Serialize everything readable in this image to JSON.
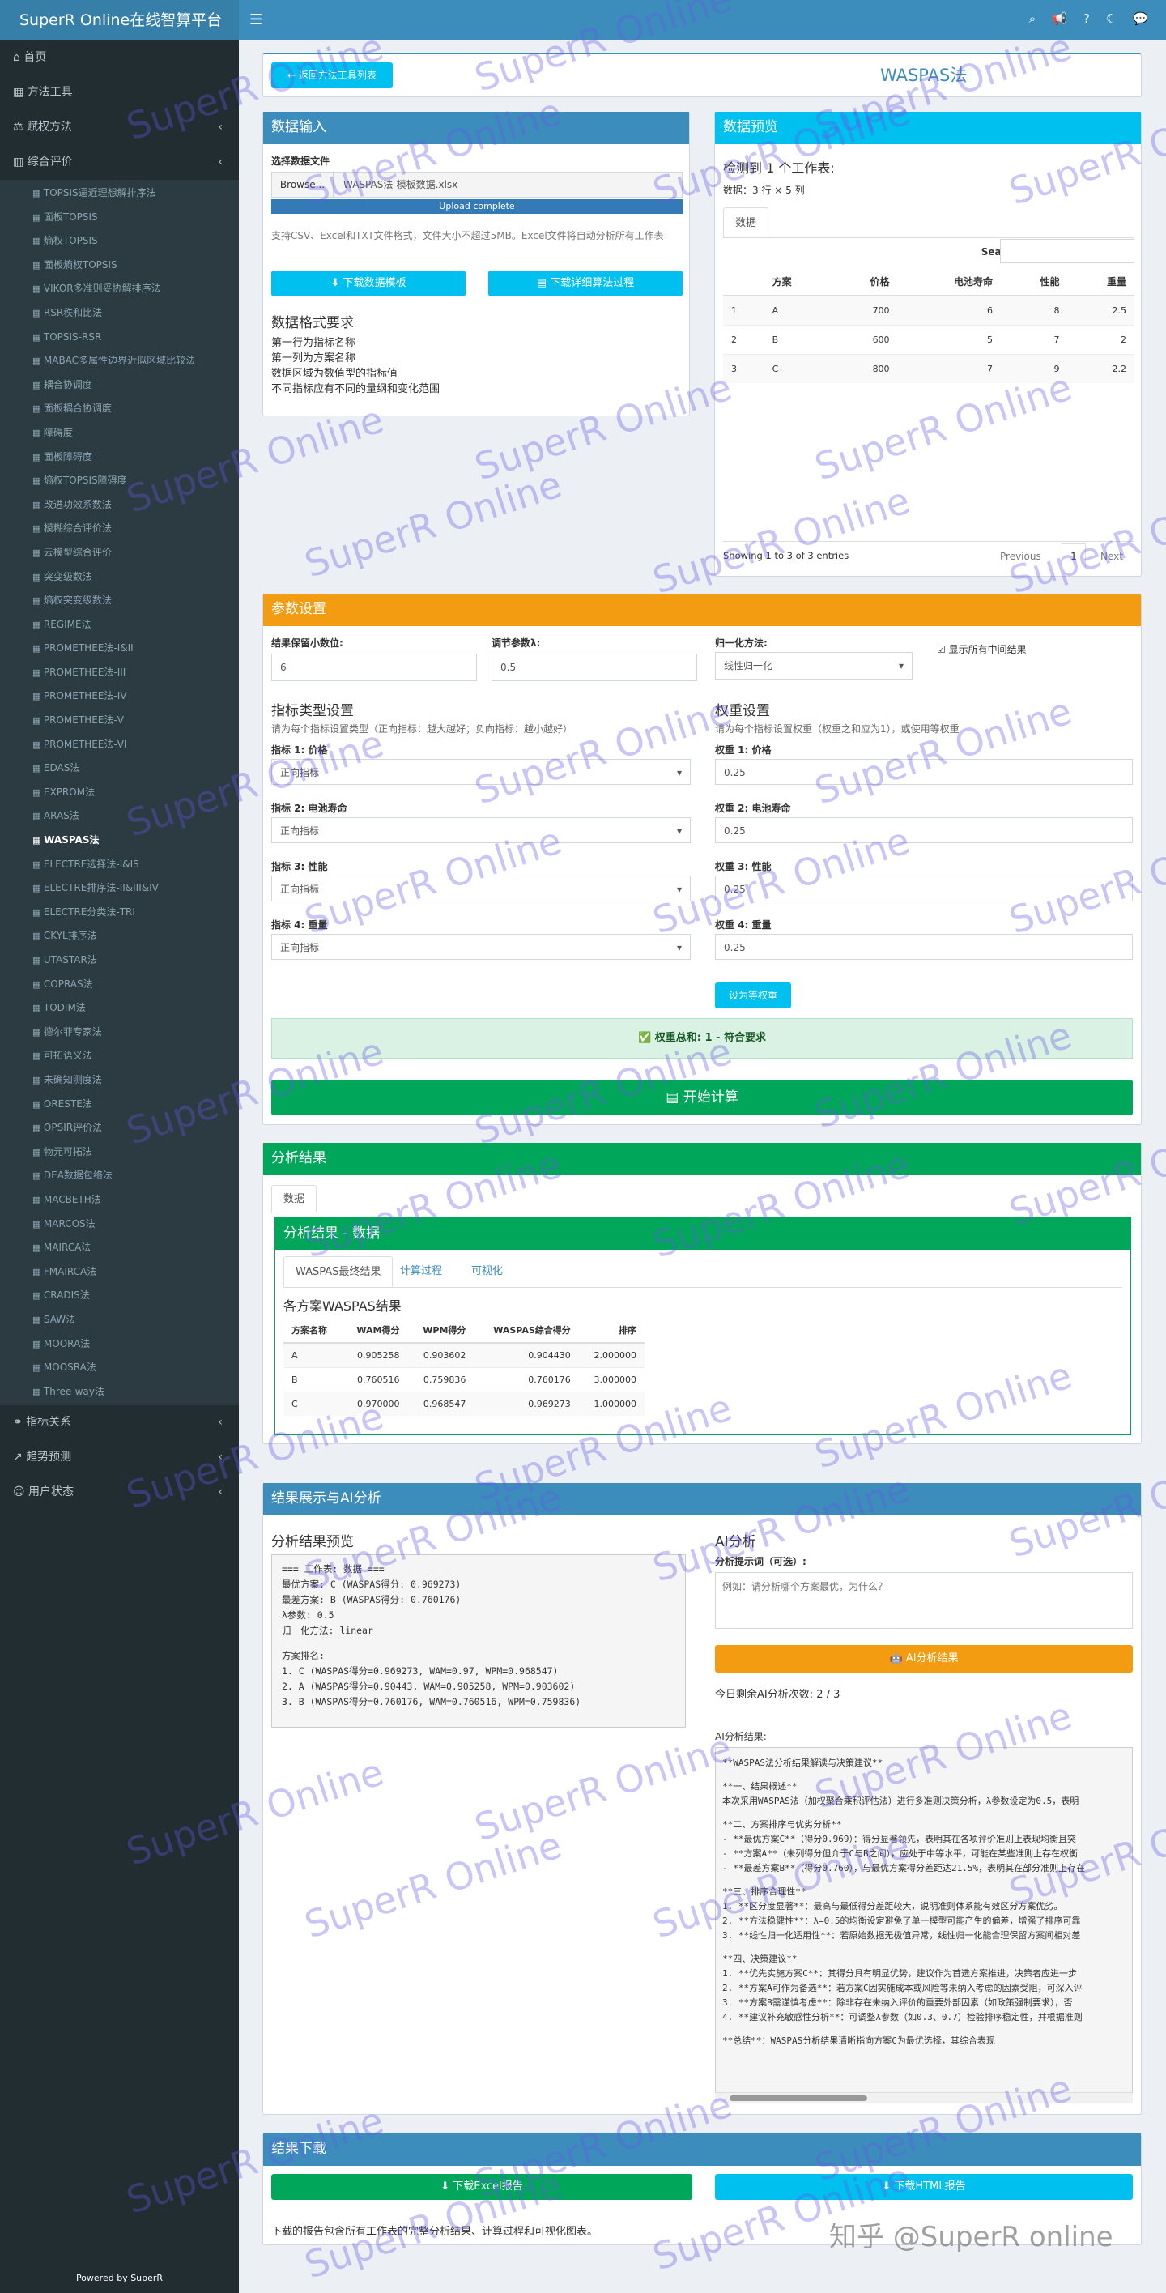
{
  "app": {
    "brand": "SuperR Online在线智算平台",
    "footer": "Powered by SuperR"
  },
  "sidebar": {
    "top": [
      {
        "label": "首页"
      },
      {
        "label": "方法工具"
      },
      {
        "label": "赋权方法"
      },
      {
        "label": "综合评价"
      }
    ],
    "sub": [
      "TOPSIS逼近理想解排序法",
      "面板TOPSIS",
      "熵权TOPSIS",
      "面板熵权TOPSIS",
      "VIKOR多准则妥协解排序法",
      "RSR秩和比法",
      "TOPSIS-RSR",
      "MABAC多属性边界近似区域比较法",
      "耦合协调度",
      "面板耦合协调度",
      "障碍度",
      "面板障碍度",
      "熵权TOPSIS障碍度",
      "改进功效系数法",
      "模糊综合评价法",
      "云模型综合评价",
      "突变级数法",
      "熵权突变级数法",
      "REGIME法",
      "PROMETHEE法-I&II",
      "PROMETHEE法-III",
      "PROMETHEE法-IV",
      "PROMETHEE法-V",
      "PROMETHEE法-VI",
      "EDAS法",
      "EXPROM法",
      "ARAS法",
      "WASPAS法",
      "ELECTRE选择法-I&IS",
      "ELECTRE排序法-II&III&IV",
      "ELECTRE分类法-TRI",
      "CKYL排序法",
      "UTASTAR法",
      "COPRAS法",
      "TODIM法",
      "德尔菲专家法",
      "可拓语义法",
      "未确知测度法",
      "ORESTE法",
      "OPSIR评价法",
      "物元可拓法",
      "DEA数据包络法",
      "MACBETH法",
      "MARCOS法",
      "MAIRCA法",
      "FMAIRCA法",
      "CRADIS法",
      "SAW法",
      "MOORA法",
      "MOOSRA法",
      "Three-way法"
    ],
    "bottom": [
      {
        "label": "指标关系"
      },
      {
        "label": "趋势预测"
      },
      {
        "label": "用户状态"
      }
    ]
  },
  "watermark": "SuperR Online",
  "header": {
    "back": "返回方法工具列表",
    "title": "WASPAS法"
  },
  "input": {
    "title": "数据输入",
    "file_label": "选择数据文件",
    "browse": "Browse...",
    "file_name": "WASPAS法-模板数据.xlsx",
    "upload": "Upload complete",
    "hint": "支持CSV、Excel和TXT文件格式，文件大小不超过5MB。Excel文件将自动分析所有工作表",
    "btn_template": "下载数据模板",
    "btn_guide": "下载详细算法过程",
    "req_title": "数据格式要求",
    "reqs": [
      "第一行为指标名称",
      "第一列为方案名称",
      "数据区域为数值型的指标值",
      "不同指标应有不同的量纲和变化范围"
    ]
  },
  "preview": {
    "title": "数据预览",
    "detect": "检测到 1 个工作表:",
    "dims": "数据：3 行 × 5 列",
    "tab": "数据",
    "search": "Search:",
    "cols": [
      "",
      "方案",
      "价格",
      "电池寿命",
      "性能",
      "重量"
    ],
    "rows": [
      [
        "1",
        "A",
        "700",
        "6",
        "8",
        "2.5"
      ],
      [
        "2",
        "B",
        "600",
        "5",
        "7",
        "2"
      ],
      [
        "3",
        "C",
        "800",
        "7",
        "9",
        "2.2"
      ]
    ],
    "showing": "Showing 1 to 3 of 3 entries",
    "prev": "Previous",
    "page": "1",
    "next": "Next"
  },
  "params": {
    "title": "参数设置",
    "dec_label": "结果保留小数位:",
    "dec": "6",
    "lambda_label": "调节参数λ:",
    "lambda": "0.5",
    "norm_label": "归一化方法:",
    "norm": "线性归一化",
    "show_all": "显示所有中间结果",
    "type_title": "指标类型设置",
    "type_hint": "请为每个指标设置类型（正向指标：越大越好；负向指标：越小越好）",
    "weight_title": "权重设置",
    "weight_hint": "请为每个指标设置权重（权重之和应为1），或使用等权重",
    "indicators": [
      {
        "name": "指标 1: 价格",
        "type": "正向指标",
        "wname": "权重 1: 价格",
        "w": "0.25"
      },
      {
        "name": "指标 2: 电池寿命",
        "type": "正向指标",
        "wname": "权重 2: 电池寿命",
        "w": "0.25"
      },
      {
        "name": "指标 3: 性能",
        "type": "正向指标",
        "wname": "权重 3: 性能",
        "w": "0.25"
      },
      {
        "name": "指标 4: 重量",
        "type": "正向指标",
        "wname": "权重 4: 重量",
        "w": "0.25"
      }
    ],
    "equal_btn": "设为等权重",
    "sum_msg": "权重总和: 1 - 符合要求",
    "calc_btn": "开始计算"
  },
  "results": {
    "title": "分析结果",
    "tab": "数据",
    "inner_title": "分析结果 - 数据",
    "tabs": [
      "WASPAS最终结果",
      "计算过程",
      "可视化"
    ],
    "table_title": "各方案WASPAS结果",
    "cols": [
      "方案名称",
      "WAM得分",
      "WPM得分",
      "WASPAS综合得分",
      "排序"
    ],
    "rows": [
      [
        "A",
        "0.905258",
        "0.903602",
        "0.904430",
        "2.000000"
      ],
      [
        "B",
        "0.760516",
        "0.759836",
        "0.760176",
        "3.000000"
      ],
      [
        "C",
        "0.970000",
        "0.968547",
        "0.969273",
        "1.000000"
      ]
    ]
  },
  "display": {
    "title": "结果展示与AI分析",
    "preview_title": "分析结果预览",
    "preview_lines": [
      "=== 工作表: 数据 ===",
      "最优方案: C (WASPAS得分: 0.969273)",
      "最差方案: B (WASPAS得分: 0.760176)",
      "λ参数: 0.5",
      "归一化方法: linear",
      "",
      "方案排名:",
      "1. C (WASPAS得分=0.969273, WAM=0.97, WPM=0.968547)",
      "2. A (WASPAS得分=0.90443, WAM=0.905258, WPM=0.903602)",
      "3. B (WASPAS得分=0.760176, WAM=0.760516, WPM=0.759836)"
    ],
    "ai_title": "AI分析",
    "prompt_label": "分析提示词（可选）:",
    "prompt_ph": "例如：请分析哪个方案最优，为什么？",
    "ai_btn": "AI分析结果",
    "remain": "今日剩余AI分析次数: 2 / 3",
    "ai_result_label": "AI分析结果:",
    "ai_lines": [
      "**WASPAS法分析结果解读与决策建议**",
      "",
      "**一、结果概述**",
      "本次采用WASPAS法（加权聚合乘积评估法）进行多准则决策分析，λ参数设定为0.5，表明",
      "",
      "**二、方案排序与优劣分析**",
      "- **最优方案C**（得分0.969）：得分显著领先，表明其在各项评价准则上表现均衡且突",
      "- **方案A**（未列得分但介于C与B之间），应处于中等水平，可能在某些准则上存在权衡",
      "- **最差方案B**（得分0.760），与最优方案得分差距达21.5%，表明其在部分准则上存在",
      "",
      "**三、排序合理性**",
      "1. **区分度显著**：最高与最低得分差距较大，说明准则体系能有效区分方案优劣。",
      "2. **方法稳健性**：λ=0.5的均衡设定避免了单一模型可能产生的偏差，增强了排序可靠",
      "3. **线性归一化适用性**：若原始数据无极值异常，线性归一化能合理保留方案间相对差",
      "",
      "**四、决策建议**",
      "1. **优先实施方案C**：其得分具有明显优势，建议作为首选方案推进，决策者应进一步",
      "2. **方案A可作为备选**：若方案C因实施成本或风险等未纳入考虑的因素受阻，可深入评",
      "3. **方案B需谨慎考虑**：除非存在未纳入评价的重要外部因素（如政策强制要求），否",
      "4. **建议补充敏感性分析**：可调整λ参数（如0.3、0.7）检验排序稳定性，并根据准则",
      "",
      "**总结**：WASPAS分析结果清晰指向方案C为最优选择，其综合表现"
    ]
  },
  "download": {
    "title": "结果下载",
    "excel": "下载Excel报告",
    "html": "下载HTML报告",
    "note": "下载的报告包含所有工作表的完整分析结果、计算过程和可视化图表。"
  },
  "corner_mark": "知乎 @SuperR online"
}
